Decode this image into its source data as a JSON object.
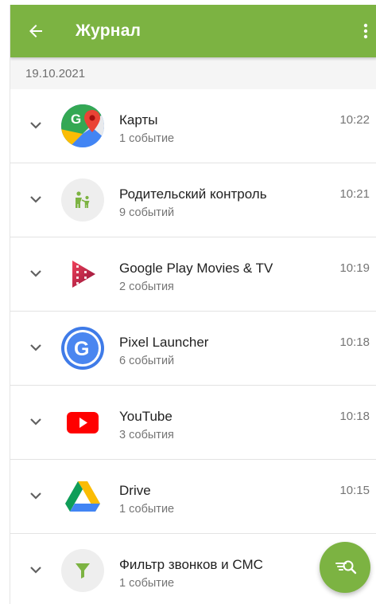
{
  "appbar": {
    "title": "Журнал",
    "back_icon": "arrow-left-icon",
    "menu_icon": "more-vert-icon",
    "color": "#7cb342"
  },
  "date_header": "19.10.2021",
  "events": [
    {
      "name": "Карты",
      "count": "1 событие",
      "time": "10:22",
      "icon": "google-maps-icon"
    },
    {
      "name": "Родительский контроль",
      "count": "9 событий",
      "time": "10:21",
      "icon": "parental-control-icon"
    },
    {
      "name": "Google Play Movies & TV",
      "count": "2 события",
      "time": "10:19",
      "icon": "play-movies-icon"
    },
    {
      "name": "Pixel Launcher",
      "count": "6 событий",
      "time": "10:18",
      "icon": "pixel-launcher-icon"
    },
    {
      "name": "YouTube",
      "count": "3 события",
      "time": "10:18",
      "icon": "youtube-icon"
    },
    {
      "name": "Drive",
      "count": "1 событие",
      "time": "10:15",
      "icon": "google-drive-icon"
    },
    {
      "name": "Фильтр звонков и СМС",
      "count": "1 событие",
      "time": "",
      "icon": "call-filter-icon"
    }
  ],
  "fab": {
    "icon": "filter-search-icon"
  }
}
